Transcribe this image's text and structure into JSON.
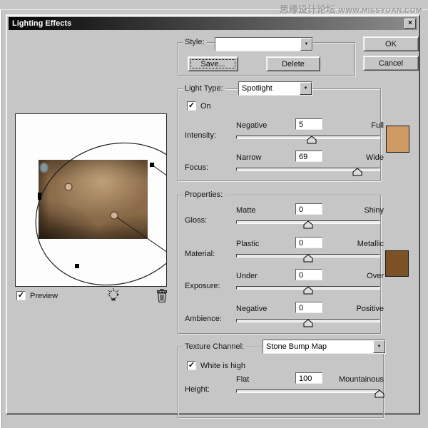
{
  "watermark": {
    "cn": "思缘设计论坛",
    "url": "WWW.MISSYUAN.COM"
  },
  "window": {
    "title": "Lighting Effects"
  },
  "icons": {
    "close": "×",
    "dropdown_arrow": "▼",
    "checkmark": "✓"
  },
  "style_group": {
    "label": "Style:",
    "selected": "",
    "save_button": "Save...",
    "delete_button": "Delete"
  },
  "actions": {
    "ok": "OK",
    "cancel": "Cancel"
  },
  "light_group": {
    "label": "Light Type:",
    "selected": "Spotlight",
    "on_label": "On",
    "on_checked": "✓"
  },
  "properties_group": {
    "label": "Properties:"
  },
  "texture_group": {
    "label": "Texture Channel:",
    "selected": "Stone Bump Map",
    "white_is_high_label": "White is high",
    "white_is_high_checked": "✓"
  },
  "preview": {
    "label": "Preview",
    "checked": "✓"
  },
  "colors": {
    "light_color": "#cf9a64",
    "material_color": "#7d5126"
  },
  "sliders": {
    "intensity": {
      "label": "Intensity:",
      "min": "Negative",
      "max": "Full",
      "value": "5",
      "pos": 52.5
    },
    "focus": {
      "label": "Focus:",
      "min": "Narrow",
      "max": "Wide",
      "value": "69",
      "pos": 84.5
    },
    "gloss": {
      "label": "Gloss:",
      "min": "Matte",
      "max": "Shiny",
      "value": "0",
      "pos": 50
    },
    "material": {
      "label": "Material:",
      "min": "Plastic",
      "max": "Metallic",
      "value": "0",
      "pos": 50
    },
    "exposure": {
      "label": "Exposure:",
      "min": "Under",
      "max": "Over",
      "value": "0",
      "pos": 50
    },
    "ambience": {
      "label": "Ambience:",
      "min": "Negative",
      "max": "Positive",
      "value": "0",
      "pos": 50
    },
    "height": {
      "label": "Height:",
      "min": "Flat",
      "max": "Mountainous",
      "value": "100",
      "pos": 100
    }
  }
}
